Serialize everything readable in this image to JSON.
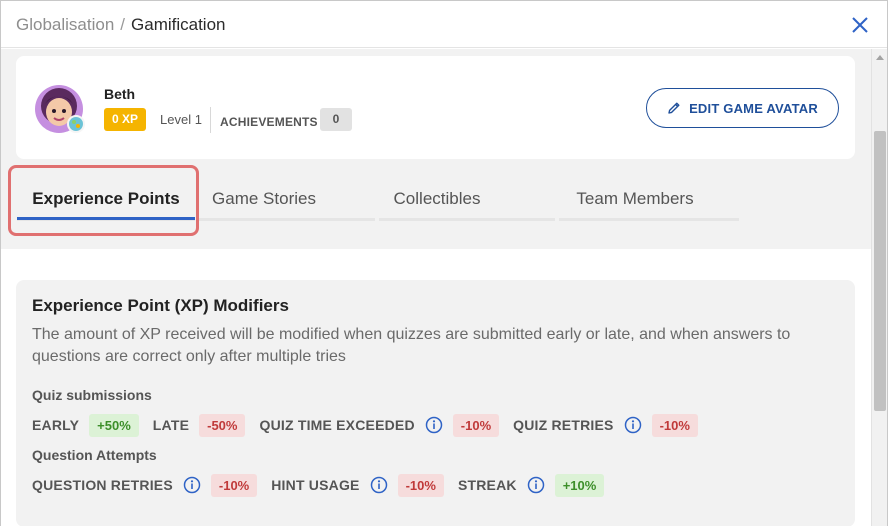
{
  "breadcrumb": {
    "parent": "Globalisation",
    "separator": "/",
    "current": "Gamification"
  },
  "profile": {
    "name": "Beth",
    "xp_badge": "0 XP",
    "level": "Level 1",
    "achievements_label": "ACHIEVEMENTS",
    "achievements_count": "0",
    "edit_button": "EDIT GAME AVATAR"
  },
  "tabs": [
    {
      "label": "Experience Points",
      "active": true
    },
    {
      "label": "Game Stories",
      "active": false
    },
    {
      "label": "Collectibles",
      "active": false
    },
    {
      "label": "Team Members",
      "active": false
    }
  ],
  "modifiers": {
    "title": "Experience Point (XP) Modifiers",
    "description": "The amount of XP received will be modified when quizzes are submitted early or late, and when answers to questions are correct only after multiple tries",
    "quiz_section": {
      "label": "Quiz submissions",
      "items": [
        {
          "label": "EARLY",
          "value": "+50%",
          "info": false
        },
        {
          "label": "LATE",
          "value": "-50%",
          "info": false
        },
        {
          "label": "QUIZ TIME EXCEEDED",
          "value": "-10%",
          "info": true
        },
        {
          "label": "QUIZ RETRIES",
          "value": "-10%",
          "info": true
        }
      ]
    },
    "question_section": {
      "label": "Question Attempts",
      "items": [
        {
          "label": "QUESTION RETRIES",
          "value": "-10%",
          "info": true
        },
        {
          "label": "HINT USAGE",
          "value": "-10%",
          "info": true
        },
        {
          "label": "STREAK",
          "value": "+10%",
          "info": true
        }
      ]
    }
  },
  "colors": {
    "accent": "#1f4f9a",
    "tab_active": "#2f63c6",
    "xp_badge": "#f5b400",
    "positive": "#3d8f2a",
    "negative": "#c03a3a",
    "highlight": "#e07070"
  },
  "icons": {
    "close": "close-icon",
    "edit": "pencil-icon",
    "info": "info-icon",
    "avatar": "avatar-icon"
  }
}
